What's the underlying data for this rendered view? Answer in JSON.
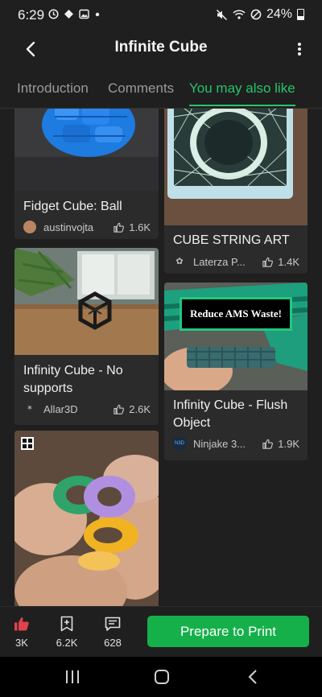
{
  "status_bar": {
    "time": "6:29",
    "battery": "24%",
    "icons": [
      "clock-icon",
      "location-icon",
      "image-icon",
      "dot-icon",
      "mute-icon",
      "wifi-icon",
      "dnd-icon",
      "battery-icon"
    ]
  },
  "header": {
    "title": "Infinite Cube"
  },
  "tabs": [
    {
      "label": "Introduction",
      "active": false
    },
    {
      "label": "Comments",
      "active": false
    },
    {
      "label": "You may also like",
      "active": true
    }
  ],
  "cards": [
    {
      "title": "Fidget Cube: Ball",
      "author": "austinvojta",
      "likes": "1.6K"
    },
    {
      "title": "Infinity Cube - No supports",
      "author": "Allar3D",
      "likes": "2.6K"
    },
    {
      "title": "CUBE STRING ART",
      "author": "Laterza P...",
      "likes": "1.4K"
    },
    {
      "title": "Infinity Cube - Flush Object",
      "author": "Ninjake 3...",
      "likes": "1.9K",
      "image_caption": "Reduce AMS Waste!",
      "avatar_text": "N3D"
    }
  ],
  "actions": {
    "like_count": "3K",
    "collect_count": "6.2K",
    "comment_count": "628",
    "print_label": "Prepare to Print"
  },
  "colors": {
    "accent": "#27c46a",
    "button": "#16b04a",
    "like": "#e0424d",
    "background": "#1f1f1f",
    "card": "#2b2b2b"
  }
}
